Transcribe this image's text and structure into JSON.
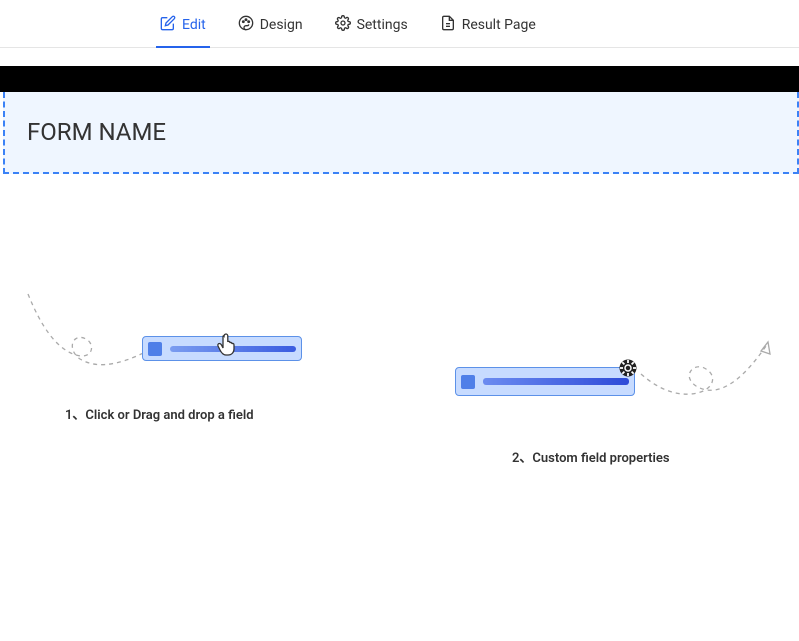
{
  "tabs": {
    "edit": "Edit",
    "design": "Design",
    "settings": "Settings",
    "result": "Result Page"
  },
  "form": {
    "name": "FORM NAME"
  },
  "hints": {
    "step1": "1、Click or Drag and drop a field",
    "step2": "2、Custom field properties"
  }
}
